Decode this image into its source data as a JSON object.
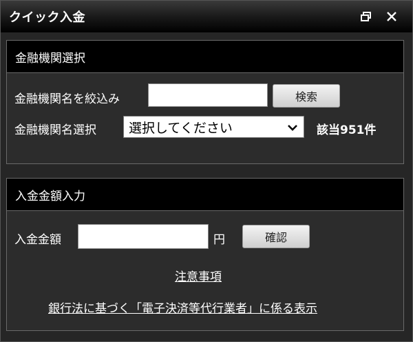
{
  "window": {
    "title": "クイック入金",
    "controls": {
      "restore_icon": "restore-window-icon",
      "close_icon": "close-icon"
    }
  },
  "bank_section": {
    "header": "金融機関選択",
    "filter_label": "金融機関名を絞込み",
    "filter_value": "",
    "search_button": "検索",
    "select_label": "金融機関名選択",
    "select_value": "選択してください",
    "match_count": "該当951件"
  },
  "amount_section": {
    "header": "入金金額入力",
    "amount_label": "入金金額",
    "amount_value": "",
    "unit": "円",
    "confirm_button": "確認",
    "notice_link": "注意事項",
    "law_link": "銀行法に基づく「電子決済等代行業者」に係る表示"
  },
  "colors": {
    "title_bar": "#000000",
    "panel_header": "#000000",
    "panel_body": "#2c2c2c",
    "border": "#6a6a6a",
    "text": "#ffffff"
  }
}
